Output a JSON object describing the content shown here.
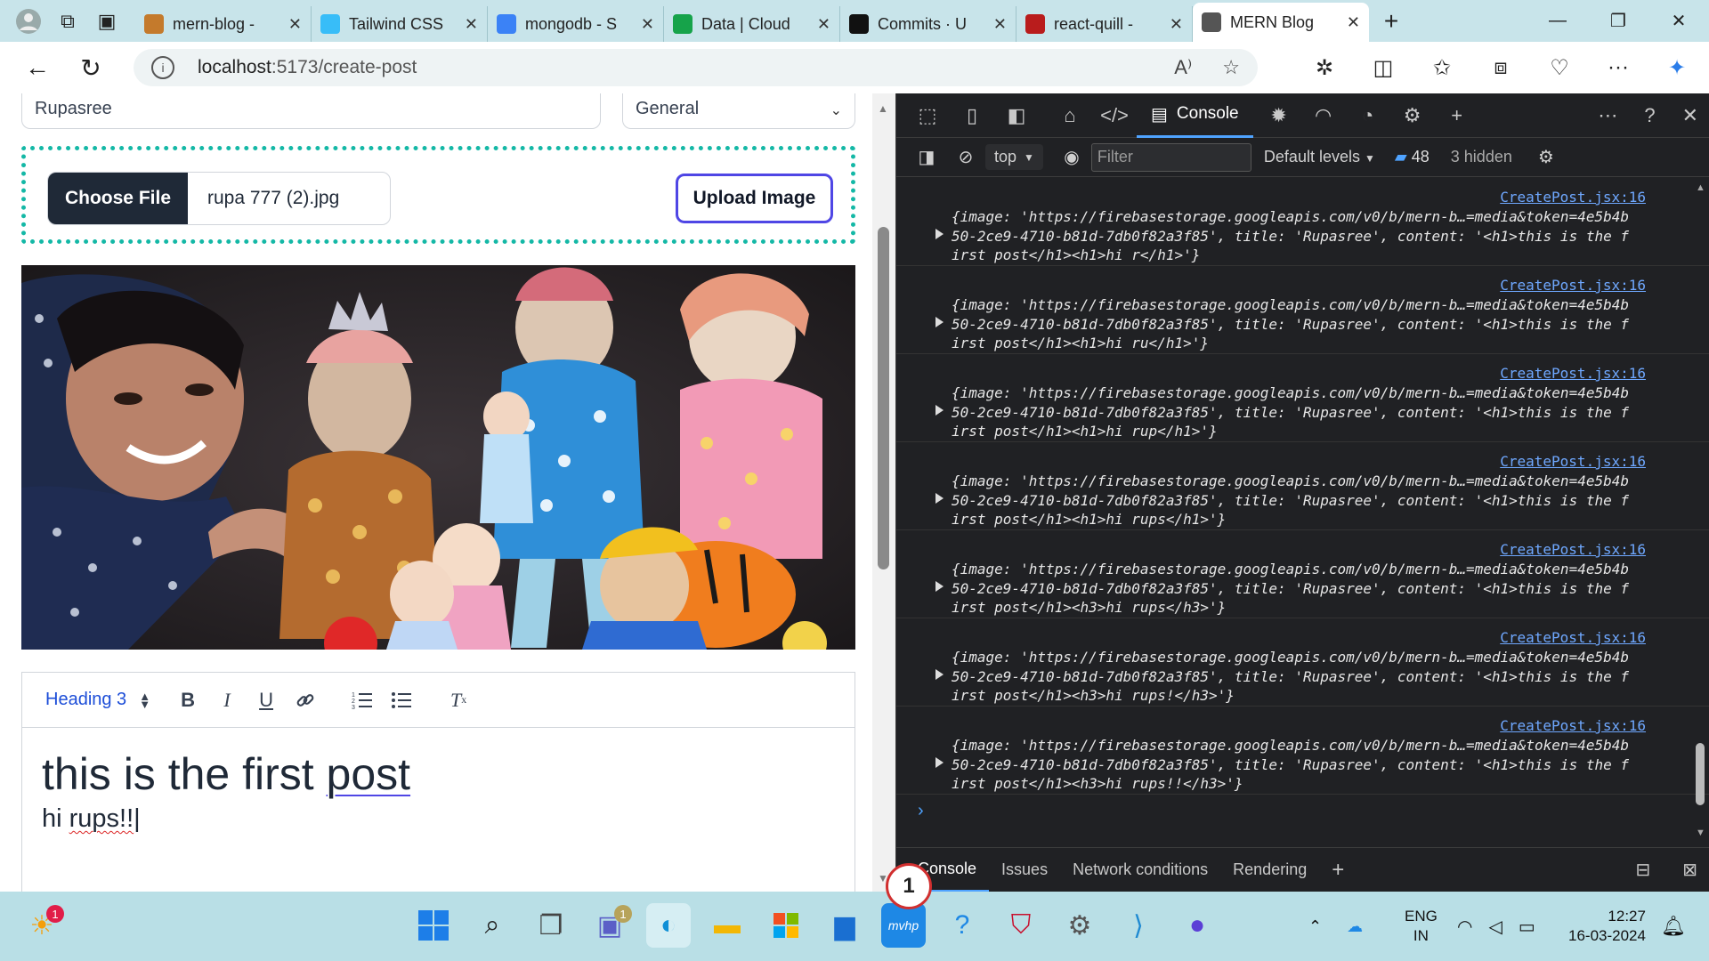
{
  "browser": {
    "tabs": [
      {
        "title": "mern-blog -",
        "favicon": "file-icon",
        "color": "#c47a2c"
      },
      {
        "title": "Tailwind CSS",
        "favicon": "tailwind-icon",
        "color": "#38bdf8"
      },
      {
        "title": "mongodb - S",
        "favicon": "search-icon",
        "color": "#3b82f6"
      },
      {
        "title": "Data | Cloud",
        "favicon": "mongodb-leaf-icon",
        "color": "#16a34a"
      },
      {
        "title": "Commits · U",
        "favicon": "github-icon",
        "color": "#111"
      },
      {
        "title": "react-quill -",
        "favicon": "npm-icon",
        "color": "#b91c1c"
      },
      {
        "title": "MERN Blog",
        "favicon": "page-icon",
        "color": "#555"
      }
    ],
    "url_host": "localhost",
    "url_path": ":5173/create-post"
  },
  "form": {
    "title_value": "Rupasree",
    "category_value": "General",
    "choose_file_label": "Choose File",
    "file_name": "rupa 777 (2).jpg",
    "upload_button_label": "Upload Image",
    "editor_format": "Heading 3",
    "content_heading": "this is the first post",
    "content_line_prefix": "hi ",
    "content_line_word": "rups!!"
  },
  "devtools": {
    "console_tab": "Console",
    "context": "top",
    "filter_placeholder": "Filter",
    "levels": "Default levels",
    "message_count": "48",
    "hidden": "3 hidden",
    "entries": [
      {
        "source": "CreatePost.jsx:16",
        "line1": "{image: 'https://firebasestorage.googleapis.com/v0/b/mern-b…=media&token=4e5b4b",
        "line2": "50-2ce9-4710-b81d-7db0f82a3f85', title: 'Rupasree', content: '<h1>this is the f",
        "line3": "irst post</h1><h1>hi r</h1>'}"
      },
      {
        "source": "CreatePost.jsx:16",
        "line1": "{image: 'https://firebasestorage.googleapis.com/v0/b/mern-b…=media&token=4e5b4b",
        "line2": "50-2ce9-4710-b81d-7db0f82a3f85', title: 'Rupasree', content: '<h1>this is the f",
        "line3": "irst post</h1><h1>hi ru</h1>'}"
      },
      {
        "source": "CreatePost.jsx:16",
        "line1": "{image: 'https://firebasestorage.googleapis.com/v0/b/mern-b…=media&token=4e5b4b",
        "line2": "50-2ce9-4710-b81d-7db0f82a3f85', title: 'Rupasree', content: '<h1>this is the f",
        "line3": "irst post</h1><h1>hi rup</h1>'}"
      },
      {
        "source": "CreatePost.jsx:16",
        "line1": "{image: 'https://firebasestorage.googleapis.com/v0/b/mern-b…=media&token=4e5b4b",
        "line2": "50-2ce9-4710-b81d-7db0f82a3f85', title: 'Rupasree', content: '<h1>this is the f",
        "line3": "irst post</h1><h1>hi rups</h1>'}"
      },
      {
        "source": "CreatePost.jsx:16",
        "line1": "{image: 'https://firebasestorage.googleapis.com/v0/b/mern-b…=media&token=4e5b4b",
        "line2": "50-2ce9-4710-b81d-7db0f82a3f85', title: 'Rupasree', content: '<h1>this is the f",
        "line3": "irst post</h1><h3>hi rups</h3>'}"
      },
      {
        "source": "CreatePost.jsx:16",
        "line1": "{image: 'https://firebasestorage.googleapis.com/v0/b/mern-b…=media&token=4e5b4b",
        "line2": "50-2ce9-4710-b81d-7db0f82a3f85', title: 'Rupasree', content: '<h1>this is the f",
        "line3": "irst post</h1><h3>hi rups!</h3>'}"
      },
      {
        "source": "CreatePost.jsx:16",
        "line1": "{image: 'https://firebasestorage.googleapis.com/v0/b/mern-b…=media&token=4e5b4b",
        "line2": "50-2ce9-4710-b81d-7db0f82a3f85', title: 'Rupasree', content: '<h1>this is the f",
        "line3": "irst post</h1><h3>hi rups!!</h3>'}"
      }
    ],
    "drawer_tabs": [
      "Console",
      "Issues",
      "Network conditions",
      "Rendering"
    ],
    "badge_number": "1"
  },
  "taskbar": {
    "weather_badge": "1",
    "chat_badge": "1",
    "lang_top": "ENG",
    "lang_bottom": "IN",
    "time": "12:27",
    "date": "16-03-2024"
  },
  "colors": {
    "accent": "#4f46e5",
    "teal_border": "#14b8a6",
    "devtools_bg": "#202124",
    "link_blue": "#6fa8ff"
  }
}
